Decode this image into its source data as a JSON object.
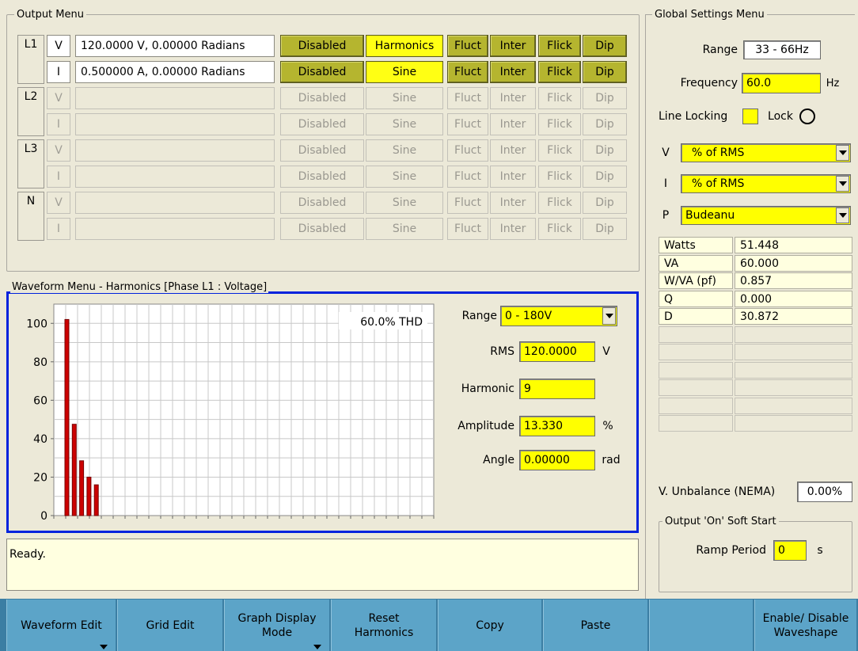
{
  "output_menu": {
    "title": "Output Menu",
    "rows": [
      {
        "phase": "L1",
        "type": "V",
        "value": "120.0000 V,   0.00000 Radians",
        "state": "Disabled",
        "wave": "Harmonics",
        "fluct": "Fluct",
        "inter": "Inter",
        "flick": "Flick",
        "dip": "Dip"
      },
      {
        "phase": "",
        "type": "I",
        "value": "0.500000 A,   0.00000 Radians",
        "state": "Disabled",
        "wave": "Sine",
        "fluct": "Fluct",
        "inter": "Inter",
        "flick": "Flick",
        "dip": "Dip"
      },
      {
        "phase": "L2",
        "type": "V",
        "value": "",
        "state": "Disabled",
        "wave": "Sine",
        "fluct": "Fluct",
        "inter": "Inter",
        "flick": "Flick",
        "dip": "Dip"
      },
      {
        "phase": "",
        "type": "I",
        "value": "",
        "state": "Disabled",
        "wave": "Sine",
        "fluct": "Fluct",
        "inter": "Inter",
        "flick": "Flick",
        "dip": "Dip"
      },
      {
        "phase": "L3",
        "type": "V",
        "value": "",
        "state": "Disabled",
        "wave": "Sine",
        "fluct": "Fluct",
        "inter": "Inter",
        "flick": "Flick",
        "dip": "Dip"
      },
      {
        "phase": "",
        "type": "I",
        "value": "",
        "state": "Disabled",
        "wave": "Sine",
        "fluct": "Fluct",
        "inter": "Inter",
        "flick": "Flick",
        "dip": "Dip"
      },
      {
        "phase": "N",
        "type": "V",
        "value": "",
        "state": "Disabled",
        "wave": "Sine",
        "fluct": "Fluct",
        "inter": "Inter",
        "flick": "Flick",
        "dip": "Dip"
      },
      {
        "phase": "",
        "type": "I",
        "value": "",
        "state": "Disabled",
        "wave": "Sine",
        "fluct": "Fluct",
        "inter": "Inter",
        "flick": "Flick",
        "dip": "Dip"
      }
    ]
  },
  "waveform_menu": {
    "title": "Waveform Menu - Harmonics [Phase L1 : Voltage]",
    "thd_label": "60.0% THD",
    "range_label": "Range",
    "range_value": "0 - 180V",
    "rms_label": "RMS",
    "rms_value": "120.0000",
    "rms_unit": "V",
    "harmonic_label": "Harmonic",
    "harmonic_value": "9",
    "amplitude_label": "Amplitude",
    "amplitude_value": "13.330",
    "amplitude_unit": "%",
    "angle_label": "Angle",
    "angle_value": "0.00000",
    "angle_unit": "rad"
  },
  "chart_data": {
    "type": "bar",
    "ylim": [
      0,
      110
    ],
    "y_ticks": [
      0,
      20,
      40,
      60,
      80,
      100
    ],
    "y_tick_labels": [
      "0",
      "20",
      "40",
      "60",
      "80",
      "100"
    ],
    "harmonics": [
      1,
      3,
      5,
      7,
      9
    ],
    "values": [
      102,
      47.5,
      28.5,
      20,
      16
    ],
    "bar_color": "#cc0000",
    "grid": true
  },
  "status": {
    "text": "Ready."
  },
  "global_settings": {
    "title": "Global Settings Menu",
    "range_label": "Range",
    "range_value": "33 - 66Hz",
    "frequency_label": "Frequency",
    "frequency_value": "60.0",
    "frequency_unit": "Hz",
    "line_locking_label": "Line Locking",
    "lock_label": "Lock",
    "v_label": "V",
    "v_mode": "% of RMS",
    "i_label": "I",
    "i_mode": "% of RMS",
    "p_label": "P",
    "p_mode": "Budeanu",
    "measurements": [
      {
        "name": "Watts",
        "value": "51.448"
      },
      {
        "name": "VA",
        "value": "60.000"
      },
      {
        "name": "W/VA (pf)",
        "value": "0.857"
      },
      {
        "name": "Q",
        "value": "0.000"
      },
      {
        "name": "D",
        "value": "30.872"
      },
      {
        "name": "",
        "value": ""
      },
      {
        "name": "",
        "value": ""
      },
      {
        "name": "",
        "value": ""
      },
      {
        "name": "",
        "value": ""
      },
      {
        "name": "",
        "value": ""
      },
      {
        "name": "",
        "value": ""
      }
    ],
    "unbalance_label": "V. Unbalance (NEMA)",
    "unbalance_value": "0.00%",
    "soft_start_title": "Output 'On' Soft Start",
    "ramp_label": "Ramp Period",
    "ramp_value": "0",
    "ramp_unit": "s"
  },
  "function_keys": [
    {
      "label": "Waveform Edit",
      "has_menu": true
    },
    {
      "label": "Grid Edit",
      "has_menu": false
    },
    {
      "label": "Graph Display\nMode",
      "has_menu": true
    },
    {
      "label": "Reset\nHarmonics",
      "has_menu": false
    },
    {
      "label": "Copy",
      "has_menu": false
    },
    {
      "label": "Paste",
      "has_menu": false
    },
    {
      "label": "",
      "has_menu": false
    },
    {
      "label": "Enable/ Disable\nWaveshape",
      "has_menu": false
    }
  ],
  "colors": {
    "accent_blue": "#0022dd",
    "highlight_yellow": "#ffff00",
    "active_olive": "#b5b52f",
    "fkey_blue": "#5ca4c8"
  }
}
